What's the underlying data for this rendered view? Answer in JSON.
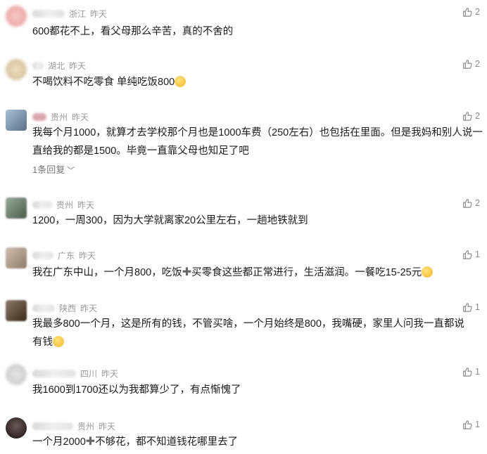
{
  "comments": [
    {
      "region": "浙江",
      "time": "昨天",
      "likes": "2",
      "text": "600都花不上，看父母那么辛苦，真的不舍的",
      "avatar_color": "#f2b8b8"
    },
    {
      "region": "湖北",
      "time": "昨天",
      "likes": "2",
      "text_a": "不喝饮料不吃零食 单纯吃饭800",
      "avatar_color": "#e4d4b8"
    },
    {
      "region": "贵州",
      "time": "昨天",
      "likes": "2",
      "text": "我每个月1000，就算才去学校那个月也是1000车费（250左右）也包括在里面。但是我妈和别人说一直给我的都是1500。毕竟一直靠父母也知足了吧",
      "reply": "1条回复",
      "avatar_color": "#8aa0b8"
    },
    {
      "region": "贵州",
      "time": "昨天",
      "likes": "2",
      "text": "1200，一周300，因为大学就离家20公里左右，一趟地铁就到",
      "avatar_color": "#6b7a6b"
    },
    {
      "region": "广东",
      "time": "昨天",
      "likes": "1",
      "text_a": "我在广东中山，一个月800，吃饭",
      "text_b": "买零食这些都正常进行，生活滋润。一餐吃15-25元",
      "avatar_color": "#b8a898"
    },
    {
      "region": "陕西",
      "time": "昨天",
      "likes": "1",
      "text_a": "我最多800一个月，这是所有的钱，不管买啥，一个月始终是800，我嘴硬，家里人问我一直都说有钱",
      "avatar_color": "#7a6a5a"
    },
    {
      "region": "四川",
      "time": "昨天",
      "likes": "1",
      "text": "我1600到1700还以为我都算少了，有点惭愧了",
      "avatar_color": "#c8c8c8"
    },
    {
      "region": "贵州",
      "time": "昨天",
      "likes": "1",
      "text_a": "一个月2000",
      "text_b": "不够花，都不知道钱花哪里去了",
      "avatar_color": "#3a3030"
    }
  ]
}
